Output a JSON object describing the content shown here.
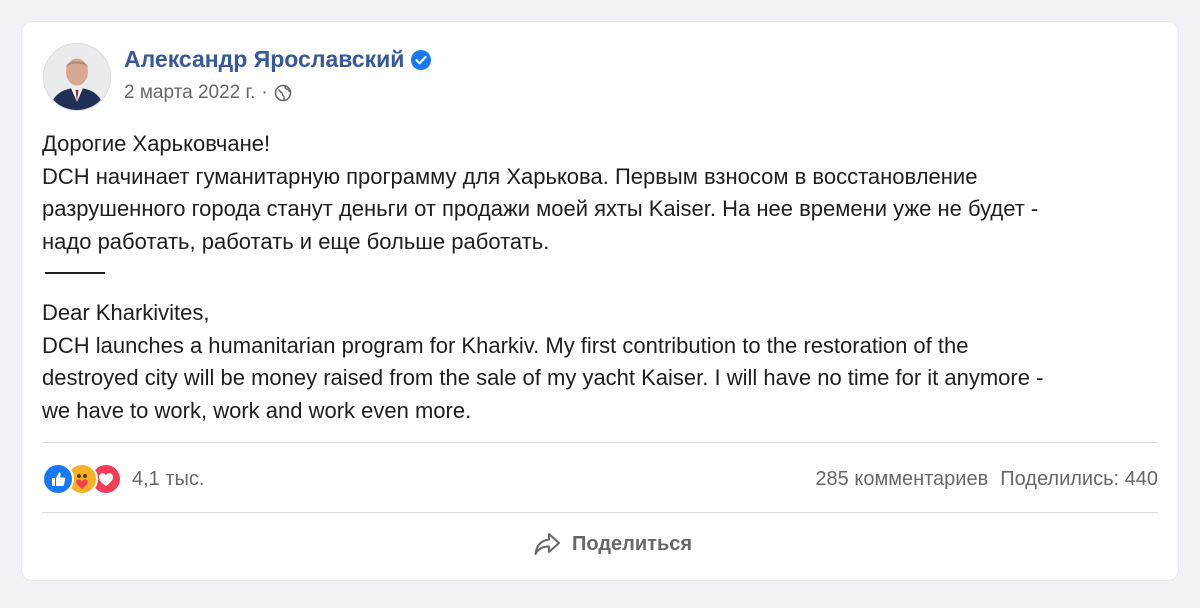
{
  "post": {
    "author": "Александр Ярославский",
    "date": "2 марта 2022 г.",
    "separator": "·",
    "audience_icon": "globe-icon",
    "verified_icon": "verified-badge-icon",
    "text_ru": [
      "Дорогие Харьковчане!",
      "DCH начинает гуманитарную программу для Харькова. Первым взносом в восстановление",
      "разрушенного города станут деньги от продажи моей яхты Kaiser. На нее времени уже не будет -",
      "надо работать, работать и еще больше работать."
    ],
    "text_en": [
      "Dear Kharkivites,",
      "DCH launches a humanitarian program for Kharkiv. My first contribution to the restoration of the",
      "destroyed city will be money raised from the sale of my yacht Kaiser. I will have no time for it anymore -",
      "we have to work, work and work even more."
    ]
  },
  "reactions": {
    "icons": [
      "like-icon",
      "care-icon",
      "love-icon"
    ],
    "count": "4,1 тыс."
  },
  "stats": {
    "comments": "285 комментариев",
    "shares": "Поделились: 440"
  },
  "actions": {
    "share_label": "Поделиться",
    "share_icon": "share-arrow-icon"
  },
  "colors": {
    "author": "#385898",
    "secondary_text": "#65676b",
    "body_text": "#1c1e21",
    "verified": "#1877f2",
    "like": "#1877f2",
    "care": "#f7b125",
    "love": "#f33e58",
    "background": "#f0f2f5"
  }
}
